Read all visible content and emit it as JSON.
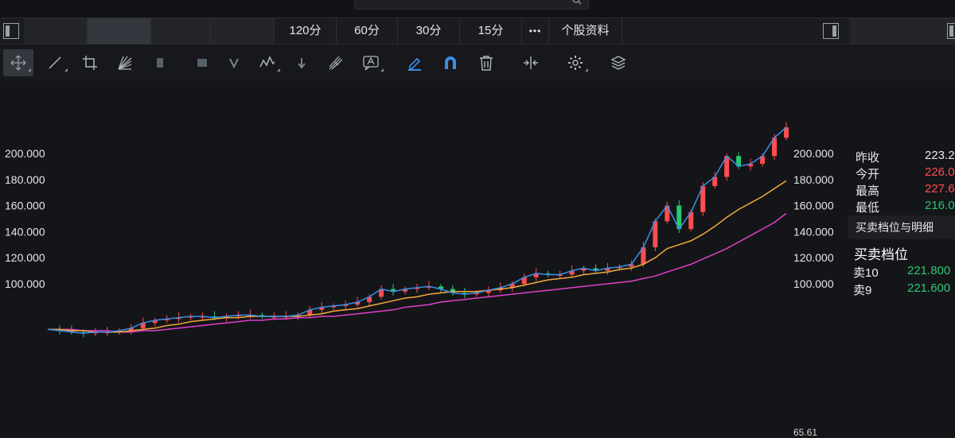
{
  "periods": {
    "items": [
      "120分",
      "60分",
      "30分",
      "15分"
    ],
    "more": "•••",
    "profile": "个股资料"
  },
  "quote": {
    "prev_close_label": "昨收",
    "prev_close_value": "223.20",
    "open_label": "今开",
    "open_value": "226.00",
    "high_label": "最高",
    "high_value": "227.60",
    "low_label": "最低",
    "low_value": "216.00"
  },
  "orderbook": {
    "tab_label": "买卖档位与明细",
    "heading": "买卖档位",
    "rows": [
      {
        "label": "卖10",
        "price": "221.800"
      },
      {
        "label": "卖9",
        "price": "221.600"
      }
    ]
  },
  "bottom": {
    "value": "65.61"
  },
  "colors": {
    "up": "#ff4d4f",
    "down": "#29c76f",
    "ma_short": "#3a8ee6",
    "ma_mid": "#f2a93b",
    "ma_long": "#e040c8"
  },
  "chart_data": {
    "type": "line",
    "ylim": [
      80,
      230
    ],
    "y_ticks": [
      "200.000",
      "180.000",
      "160.000",
      "140.000",
      "120.000",
      "100.000"
    ],
    "price": [
      65,
      64,
      63,
      62,
      63,
      63,
      64,
      66,
      70,
      72,
      73,
      74,
      75,
      75,
      74,
      75,
      76,
      76,
      75,
      75,
      75,
      76,
      80,
      82,
      83,
      84,
      86,
      90,
      96,
      94,
      96,
      97,
      98,
      96,
      93,
      92,
      93,
      95,
      97,
      100,
      105,
      108,
      107,
      107,
      110,
      112,
      110,
      112,
      113,
      115,
      128,
      148,
      160,
      142,
      155,
      175,
      182,
      198,
      190,
      192,
      198,
      212,
      220
    ],
    "ma_mid": [
      65,
      65,
      64,
      64,
      63,
      63,
      63,
      64,
      65,
      66,
      68,
      69,
      71,
      72,
      73,
      74,
      74,
      75,
      75,
      75,
      75,
      75,
      76,
      77,
      79,
      80,
      81,
      83,
      85,
      87,
      89,
      90,
      92,
      93,
      94,
      94,
      94,
      95,
      96,
      97,
      99,
      101,
      103,
      104,
      105,
      107,
      108,
      109,
      111,
      112,
      115,
      120,
      127,
      130,
      133,
      138,
      144,
      151,
      157,
      162,
      167,
      173,
      179
    ],
    "ma_long": [
      65,
      65,
      65,
      64,
      64,
      64,
      63,
      63,
      64,
      64,
      65,
      66,
      67,
      68,
      69,
      70,
      71,
      72,
      72,
      73,
      73,
      74,
      74,
      75,
      75,
      76,
      77,
      78,
      79,
      80,
      82,
      83,
      84,
      86,
      87,
      88,
      89,
      90,
      91,
      92,
      93,
      94,
      95,
      96,
      97,
      98,
      99,
      100,
      101,
      102,
      104,
      106,
      109,
      112,
      115,
      119,
      123,
      127,
      132,
      137,
      142,
      147,
      154
    ]
  }
}
